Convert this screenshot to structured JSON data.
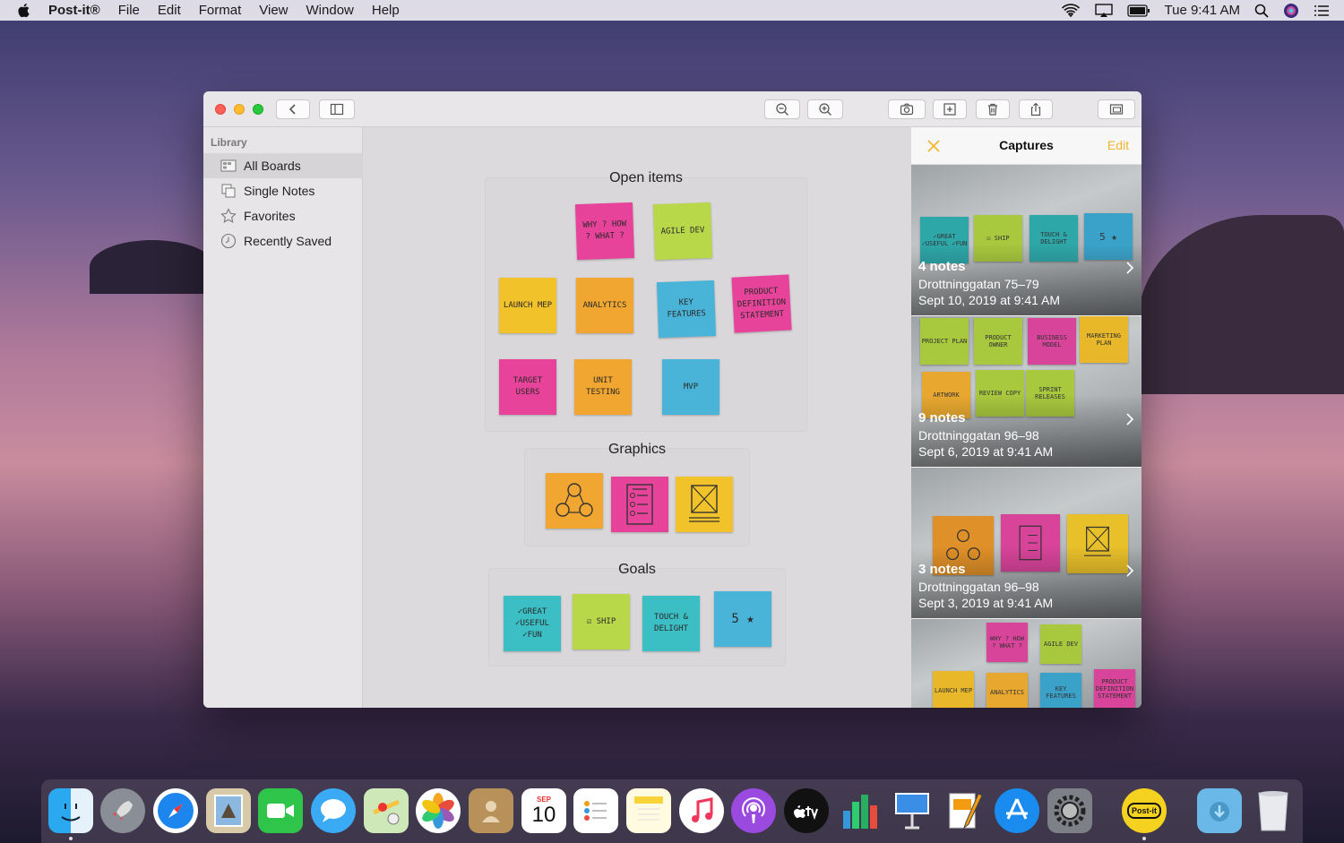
{
  "menubar": {
    "app_name": "Post-it®",
    "menus": [
      "File",
      "Edit",
      "Format",
      "View",
      "Window",
      "Help"
    ],
    "clock": "Tue 9:41 AM"
  },
  "sidebar": {
    "header": "Library",
    "items": [
      {
        "label": "All Boards",
        "icon": "boards-icon",
        "selected": true
      },
      {
        "label": "Single Notes",
        "icon": "single-notes-icon",
        "selected": false
      },
      {
        "label": "Favorites",
        "icon": "star-icon",
        "selected": false
      },
      {
        "label": "Recently Saved",
        "icon": "clock-icon",
        "selected": false
      }
    ]
  },
  "board": {
    "groups": [
      {
        "title": "Open items",
        "notes": [
          {
            "text": "WHY ? HOW ? WHAT ?",
            "color": "#e8439a"
          },
          {
            "text": "AGILE DEV",
            "color": "#b8d84a"
          },
          {
            "text": "LAUNCH MEP",
            "color": "#f2c22a"
          },
          {
            "text": "ANALYTICS",
            "color": "#f0a630"
          },
          {
            "text": "KEY FEATURES",
            "color": "#4ab3d8"
          },
          {
            "text": "PRODUCT DEFINITION STATEMENT",
            "color": "#e8439a"
          },
          {
            "text": "TARGET USERS",
            "color": "#e8439a"
          },
          {
            "text": "UNIT TESTING",
            "color": "#f0a630"
          },
          {
            "text": "MVP",
            "color": "#4ab3d8"
          }
        ]
      },
      {
        "title": "Graphics",
        "notes": [
          {
            "text": "",
            "color": "#f0a630",
            "icon": "cycle-drawing-icon"
          },
          {
            "text": "",
            "color": "#e8439a",
            "icon": "list-drawing-icon"
          },
          {
            "text": "",
            "color": "#f2c22a",
            "icon": "box-drawing-icon"
          }
        ]
      },
      {
        "title": "Goals",
        "notes": [
          {
            "text": "✓GREAT ✓USEFUL ✓FUN",
            "color": "#3cbfc4"
          },
          {
            "text": "☑ SHIP",
            "color": "#b8d84a"
          },
          {
            "text": "TOUCH & DELIGHT",
            "color": "#3cbfc4"
          },
          {
            "text": "5 ★",
            "color": "#4ab3d8"
          }
        ]
      }
    ]
  },
  "captures": {
    "title": "Captures",
    "edit_label": "Edit",
    "accent": "#f2b632",
    "items": [
      {
        "count": "4 notes",
        "address": "Drottninggatan 75–79",
        "date": "Sept 10, 2019 at 9:41 AM"
      },
      {
        "count": "9 notes",
        "address": "Drottninggatan 96–98",
        "date": "Sept 6, 2019 at 9:41 AM"
      },
      {
        "count": "3 notes",
        "address": "Drottninggatan 96–98",
        "date": "Sept 3, 2019 at 9:41 AM"
      }
    ],
    "minis_1": [
      "✓GREAT ✓USEFUL ✓FUN",
      "☑ SHIP",
      "TOUCH & DELIGHT",
      "5 ★"
    ],
    "minis_2": [
      "PROJECT PLAN",
      "PRODUCT OWNER",
      "BUSINESS MODEL",
      "MARKETING PLAN",
      "ARTWORK",
      "REVIEW COPY",
      "SPRINT RELEASES"
    ],
    "minis_4": [
      "WHY ? HOW ? WHAT ?",
      "AGILE DEV",
      "LAUNCH MEP",
      "ANALYTICS",
      "KEY FEATURES",
      "PRODUCT DEFINITION STATEMENT"
    ]
  },
  "dock": {
    "calendar_month": "SEP",
    "calendar_day": "10",
    "postit_label": "Post-it"
  }
}
